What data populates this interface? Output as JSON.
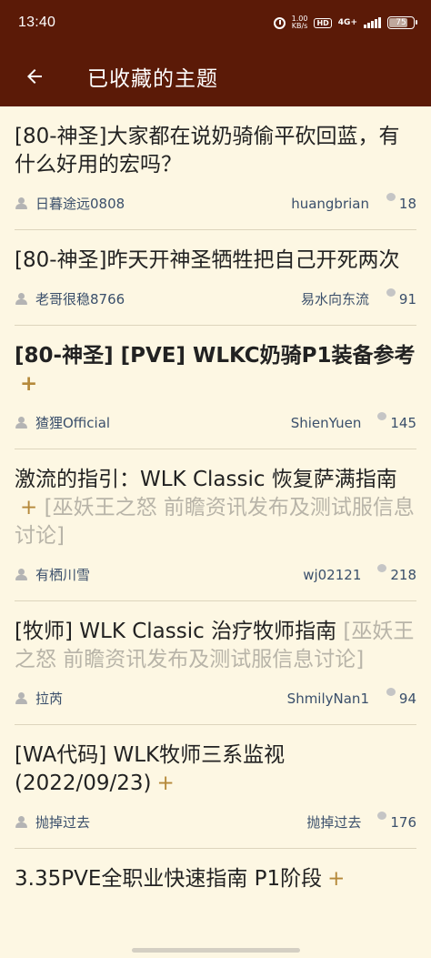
{
  "status": {
    "time": "13:40",
    "speed_top": "1.00",
    "speed_bottom": "KB/s",
    "hd": "HD",
    "network": "4G+",
    "battery": "75"
  },
  "appbar": {
    "title": "已收藏的主题"
  },
  "items": [
    {
      "title": "[80-神圣]大家都在说奶骑偷平砍回蓝，有什么好用的宏吗？",
      "bold": false,
      "plus": "",
      "forum": "",
      "author": "日暮途远0808",
      "last": "huangbrian",
      "replies": "18"
    },
    {
      "title": "[80-神圣]昨天开神圣牺牲把自己开死两次",
      "bold": false,
      "plus": "",
      "forum": "",
      "author": "老哥很稳8766",
      "last": "易水向东流",
      "replies": "91"
    },
    {
      "title": "[80-神圣] [PVE] WLKC奶骑P1装备参考",
      "bold": true,
      "plus": "+",
      "forum": "",
      "author": "猹狸Official",
      "last": "ShienYuen",
      "replies": "145"
    },
    {
      "title": "激流的指引：WLK Classic 恢复萨满指南",
      "bold": false,
      "plus": "+",
      "forum": "[巫妖王之怒 前瞻资讯发布及测试服信息讨论]",
      "author": "有栖川雪",
      "last": "wj02121",
      "replies": "218"
    },
    {
      "title": "[牧师] WLK Classic 治疗牧师指南",
      "bold": false,
      "plus": "",
      "forum": "[巫妖王之怒 前瞻资讯发布及测试服信息讨论]",
      "author": "拉芮",
      "last": "ShmilyNan1",
      "replies": "94"
    },
    {
      "title": "[WA代码] WLK牧师三系监视(2022/09/23)",
      "bold": false,
      "plus": "+",
      "forum": "",
      "author": "抛掉过去",
      "last": "抛掉过去",
      "replies": "176"
    },
    {
      "title": "3.35PVE全职业快速指南 P1阶段",
      "bold": false,
      "plus": "+",
      "forum": "",
      "author": "",
      "last": "",
      "replies": ""
    }
  ]
}
